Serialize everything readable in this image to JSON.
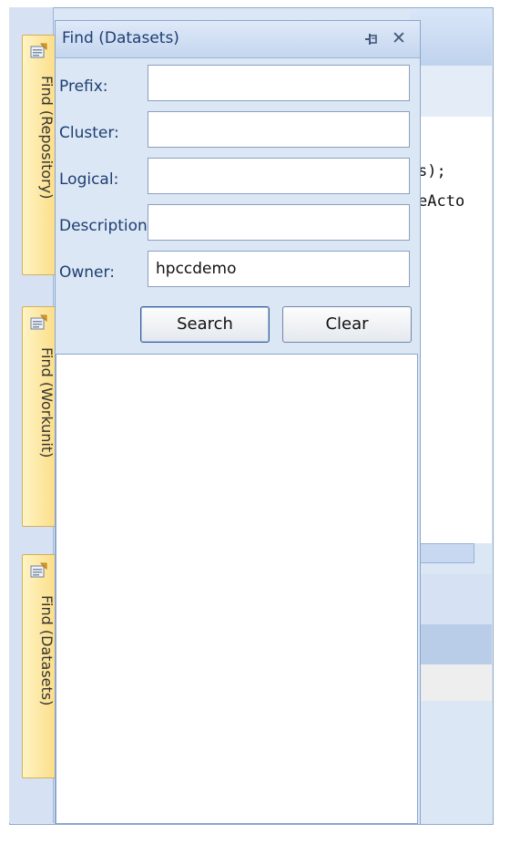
{
  "ide": {
    "code_lines": [
      "s);",
      "eActo"
    ]
  },
  "side_tabs": [
    {
      "label": "Find (Repository)",
      "icon": "find-properties-icon"
    },
    {
      "label": "Find (Workunit)",
      "icon": "find-properties-icon"
    },
    {
      "label": "Find (Datasets)",
      "icon": "find-properties-icon"
    }
  ],
  "panel": {
    "title": "Find (Datasets)",
    "pin_glyph": "⊣",
    "close_glyph": "✕"
  },
  "fields": {
    "prefix": {
      "label": "Prefix:",
      "value": ""
    },
    "cluster": {
      "label": "Cluster:",
      "value": ""
    },
    "logical": {
      "label": "Logical:",
      "value": ""
    },
    "description": {
      "label": "Description:",
      "value": ""
    },
    "owner": {
      "label": "Owner:",
      "value": "hpccdemo"
    }
  },
  "buttons": {
    "search": "Search",
    "clear": "Clear"
  }
}
